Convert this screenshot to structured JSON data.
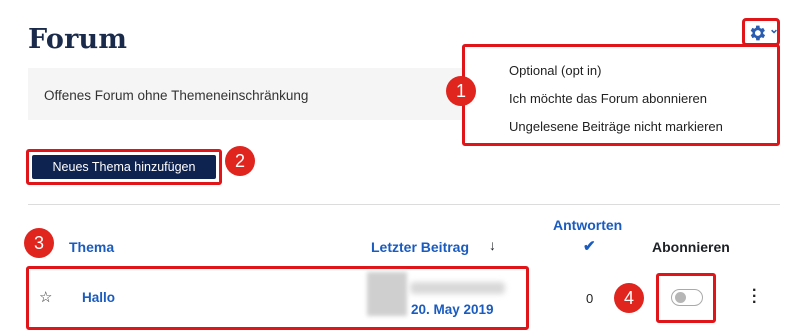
{
  "page": {
    "title": "Forum"
  },
  "description": "Offenes Forum ohne Themeneinschränkung",
  "settings_menu": {
    "items": [
      "Optional (opt in)",
      "Ich möchte das Forum abonnieren",
      "Ungelesene Beiträge nicht markieren"
    ]
  },
  "actions": {
    "add_topic": "Neues Thema hinzufügen"
  },
  "table": {
    "headers": {
      "topic": "Thema",
      "last_post": "Letzter Beitrag",
      "sort_arrow": "↓",
      "replies": "Antworten",
      "subscribe": "Abonnieren"
    },
    "rows": [
      {
        "topic": "Hallo",
        "last_post_date": "20. May 2019",
        "replies": "0",
        "subscribed": false
      }
    ]
  },
  "annotations": [
    "1",
    "2",
    "3",
    "4"
  ],
  "icons": {
    "settings": "gear-icon",
    "caret": "caret-down-icon",
    "star": "star-outline-icon",
    "sorted": "check-icon",
    "more": "kebab-icon"
  },
  "colors": {
    "accent": "#1a5bbf",
    "highlight": "#e0151a",
    "button": "#0f2350"
  }
}
